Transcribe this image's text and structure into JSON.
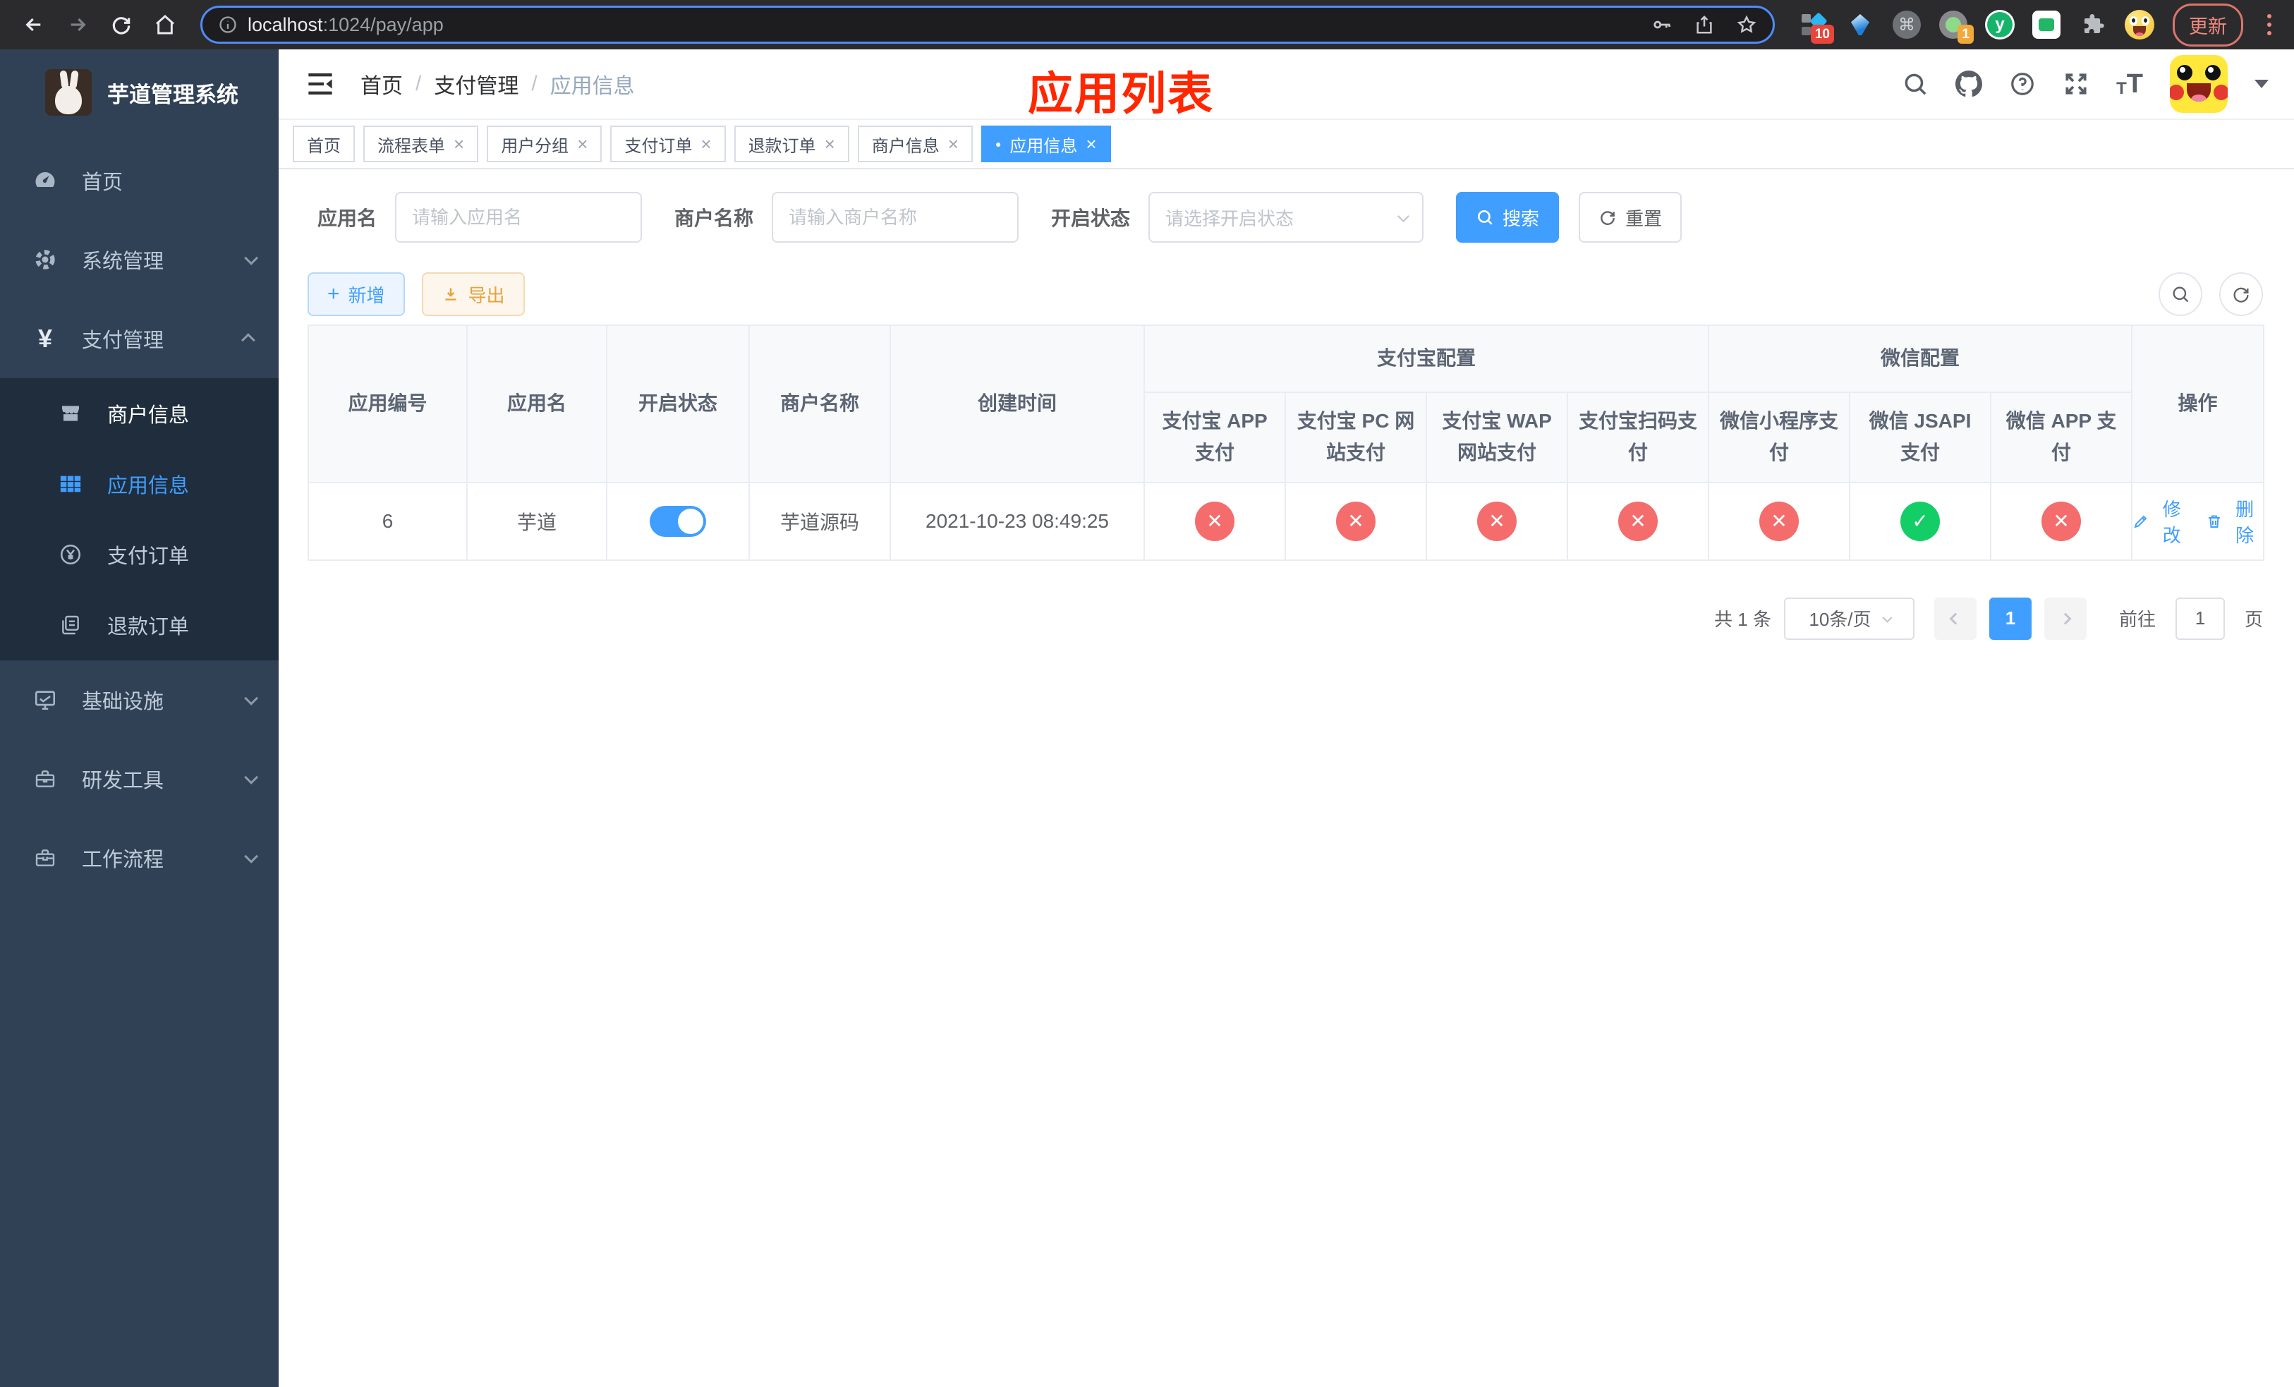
{
  "browser": {
    "url_host": "localhost",
    "url_rest": ":1024/pay/app",
    "ext_badge_count": "10",
    "ext_badge_one": "1",
    "yuque_letter": "y",
    "clover_glyph": "⌘",
    "update_label": "更新"
  },
  "sidebar": {
    "title": "芋道管理系统",
    "items": [
      {
        "label": "首页",
        "icon": "dashboard-icon"
      },
      {
        "label": "系统管理",
        "icon": "gear-icon"
      },
      {
        "label": "支付管理",
        "icon": "yen-icon",
        "icon_glyph": "¥"
      },
      {
        "label": "基础设施",
        "icon": "monitor-icon"
      },
      {
        "label": "研发工具",
        "icon": "toolbox-icon"
      },
      {
        "label": "工作流程",
        "icon": "briefcase-icon"
      }
    ],
    "pay_children": [
      {
        "label": "商户信息",
        "icon": "shop-icon"
      },
      {
        "label": "应用信息",
        "icon": "grid-icon",
        "active": true
      },
      {
        "label": "支付订单",
        "icon": "coin-icon"
      },
      {
        "label": "退款订单",
        "icon": "document-icon"
      }
    ]
  },
  "navbar": {
    "breadcrumb": [
      "首页",
      "支付管理",
      "应用信息"
    ],
    "separator": "/"
  },
  "annotation": "应用列表",
  "tabs": [
    {
      "label": "首页",
      "closable": false
    },
    {
      "label": "流程表单",
      "closable": true
    },
    {
      "label": "用户分组",
      "closable": true
    },
    {
      "label": "支付订单",
      "closable": true
    },
    {
      "label": "退款订单",
      "closable": true
    },
    {
      "label": "商户信息",
      "closable": true
    },
    {
      "label": "应用信息",
      "closable": true,
      "active": true
    }
  ],
  "filters": {
    "app_name_label": "应用名",
    "app_name_placeholder": "请输入应用名",
    "merchant_label": "商户名称",
    "merchant_placeholder": "请输入商户名称",
    "status_label": "开启状态",
    "status_placeholder": "请选择开启状态",
    "search_label": "搜索",
    "reset_label": "重置"
  },
  "toolbar": {
    "add_label": "新增",
    "add_glyph": "+",
    "export_label": "导出"
  },
  "table": {
    "main_headers": [
      "应用编号",
      "应用名",
      "开启状态",
      "商户名称",
      "创建时间"
    ],
    "group_alipay": "支付宝配置",
    "group_wechat": "微信配置",
    "sub_headers": [
      "支付宝 APP 支付",
      "支付宝 PC 网站支付",
      "支付宝 WAP 网站支付",
      "支付宝扫码支付",
      "微信小程序支付",
      "微信 JSAPI 支付",
      "微信 APP 支付"
    ],
    "action_header": "操作",
    "rows": [
      {
        "id": "6",
        "name": "芋道",
        "enabled": true,
        "merchant": "芋道源码",
        "created": "2021-10-23 08:49:25",
        "statuses": [
          "no",
          "no",
          "no",
          "no",
          "no",
          "yes",
          "no"
        ],
        "edit_label": "修改",
        "delete_label": "删除"
      }
    ]
  },
  "pagination": {
    "total": "共 1 条",
    "page_size": "10条/页",
    "current_page": "1",
    "goto_label": "前往",
    "goto_value": "1",
    "page_unit": "页"
  },
  "ui": {
    "close_glyph": "×",
    "dot_glyph": "●",
    "check_glyph": "✓",
    "cross_glyph": "✕",
    "font_icon_letter": "T"
  },
  "colors": {
    "accent": "#409eff",
    "success": "#13ce66",
    "danger": "#f56c6c",
    "warning": "#e6a23c",
    "sidebar_bg": "#304156",
    "submenu_bg": "#1f2d3d",
    "annotation_red": "#ff2600"
  }
}
